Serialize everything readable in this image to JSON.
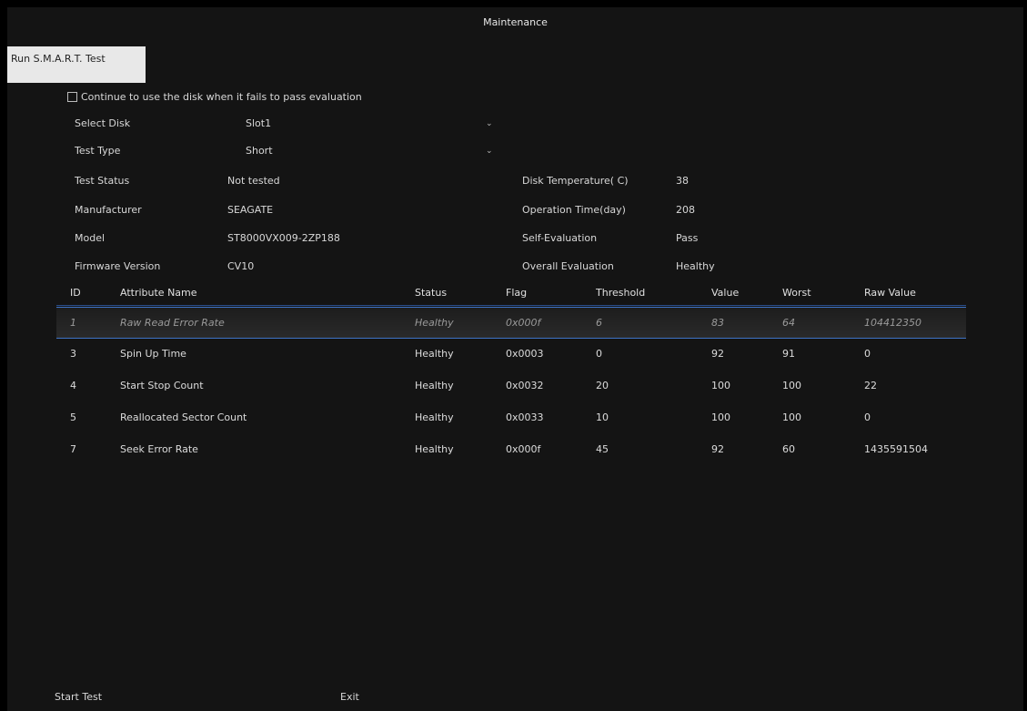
{
  "window": {
    "title": "Maintenance"
  },
  "tab": {
    "label": "Run S.M.A.R.T. Test"
  },
  "options": {
    "continue_checkbox_label": "Continue to use the disk when it fails to pass evaluation",
    "continue_checked": false
  },
  "form": {
    "select_disk_label": "Select Disk",
    "select_disk_value": "Slot1",
    "test_type_label": "Test Type",
    "test_type_value": "Short",
    "test_status_label": "Test Status",
    "test_status_value": "Not tested",
    "manufacturer_label": "Manufacturer",
    "manufacturer_value": "SEAGATE",
    "model_label": "Model",
    "model_value": "ST8000VX009-2ZP188",
    "firmware_label": "Firmware Version",
    "firmware_value": "CV10",
    "temperature_label": "Disk Temperature( C)",
    "temperature_value": "38",
    "operation_time_label": "Operation Time(day)",
    "operation_time_value": "208",
    "self_eval_label": "Self-Evaluation",
    "self_eval_value": "Pass",
    "overall_eval_label": "Overall Evaluation",
    "overall_eval_value": "Healthy"
  },
  "table": {
    "headers": {
      "id": "ID",
      "name": "Attribute Name",
      "status": "Status",
      "flag": "Flag",
      "threshold": "Threshold",
      "value": "Value",
      "worst": "Worst",
      "raw": "Raw Value"
    },
    "rows": [
      {
        "id": "1",
        "name": "Raw Read Error Rate",
        "status": "Healthy",
        "flag": "0x000f",
        "threshold": "6",
        "value": "83",
        "worst": "64",
        "raw": "104412350",
        "selected": true
      },
      {
        "id": "3",
        "name": "Spin Up Time",
        "status": "Healthy",
        "flag": "0x0003",
        "threshold": "0",
        "value": "92",
        "worst": "91",
        "raw": "0",
        "selected": false
      },
      {
        "id": "4",
        "name": "Start Stop Count",
        "status": "Healthy",
        "flag": "0x0032",
        "threshold": "20",
        "value": "100",
        "worst": "100",
        "raw": "22",
        "selected": false
      },
      {
        "id": "5",
        "name": "Reallocated Sector Count",
        "status": "Healthy",
        "flag": "0x0033",
        "threshold": "10",
        "value": "100",
        "worst": "100",
        "raw": "0",
        "selected": false
      },
      {
        "id": "7",
        "name": "Seek Error Rate",
        "status": "Healthy",
        "flag": "0x000f",
        "threshold": "45",
        "value": "92",
        "worst": "60",
        "raw": "1435591504",
        "selected": false
      }
    ]
  },
  "footer": {
    "start_test_label": "Start Test",
    "exit_label": "Exit"
  }
}
